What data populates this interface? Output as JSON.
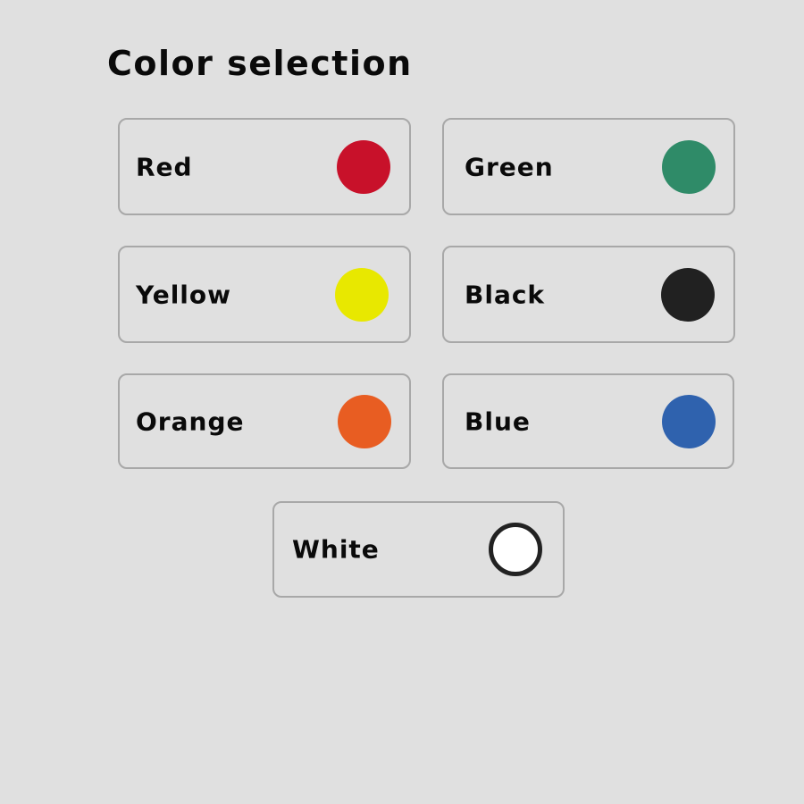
{
  "title": "Color selection",
  "colors": [
    {
      "label": "Red",
      "hex": "#c8112a"
    },
    {
      "label": "Green",
      "hex": "#2f8b68"
    },
    {
      "label": "Yellow",
      "hex": "#e8e800"
    },
    {
      "label": "Black",
      "hex": "#212121"
    },
    {
      "label": "Orange",
      "hex": "#e85d22"
    },
    {
      "label": "Blue",
      "hex": "#2f62ae"
    },
    {
      "label": "White",
      "hex": "#ffffff",
      "outline": "#222222"
    }
  ]
}
